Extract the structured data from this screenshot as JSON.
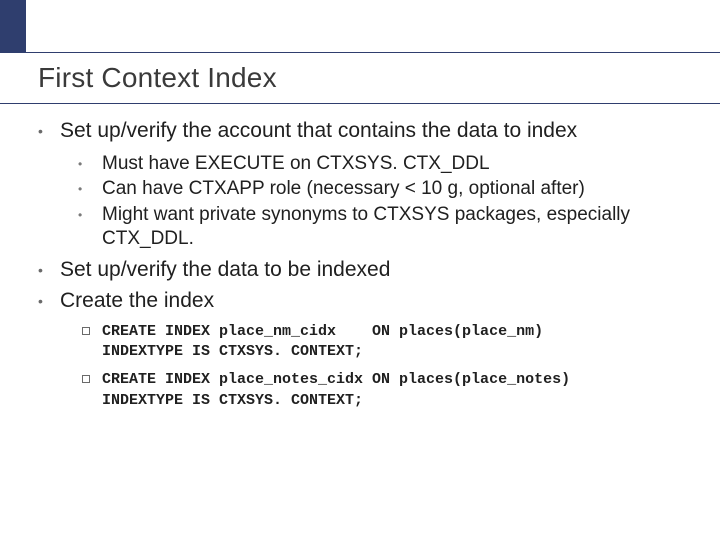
{
  "title": "First Context Index",
  "bullets": {
    "b1": "Set up/verify the account that contains the data to index",
    "b1_sub1": "Must have EXECUTE on CTXSYS. CTX_DDL",
    "b1_sub2": "Can have CTXAPP role (necessary < 10 g, optional after)",
    "b1_sub3": "Might want private synonyms to CTXSYS packages, especially CTX_DDL.",
    "b2": "Set up/verify the data to be indexed",
    "b3": "Create the index",
    "b3_code1": "CREATE INDEX place_nm_cidx    ON places(place_nm)\nINDEXTYPE IS CTXSYS. CONTEXT;",
    "b3_code2": "CREATE INDEX place_notes_cidx ON places(place_notes)\nINDEXTYPE IS CTXSYS. CONTEXT;"
  }
}
